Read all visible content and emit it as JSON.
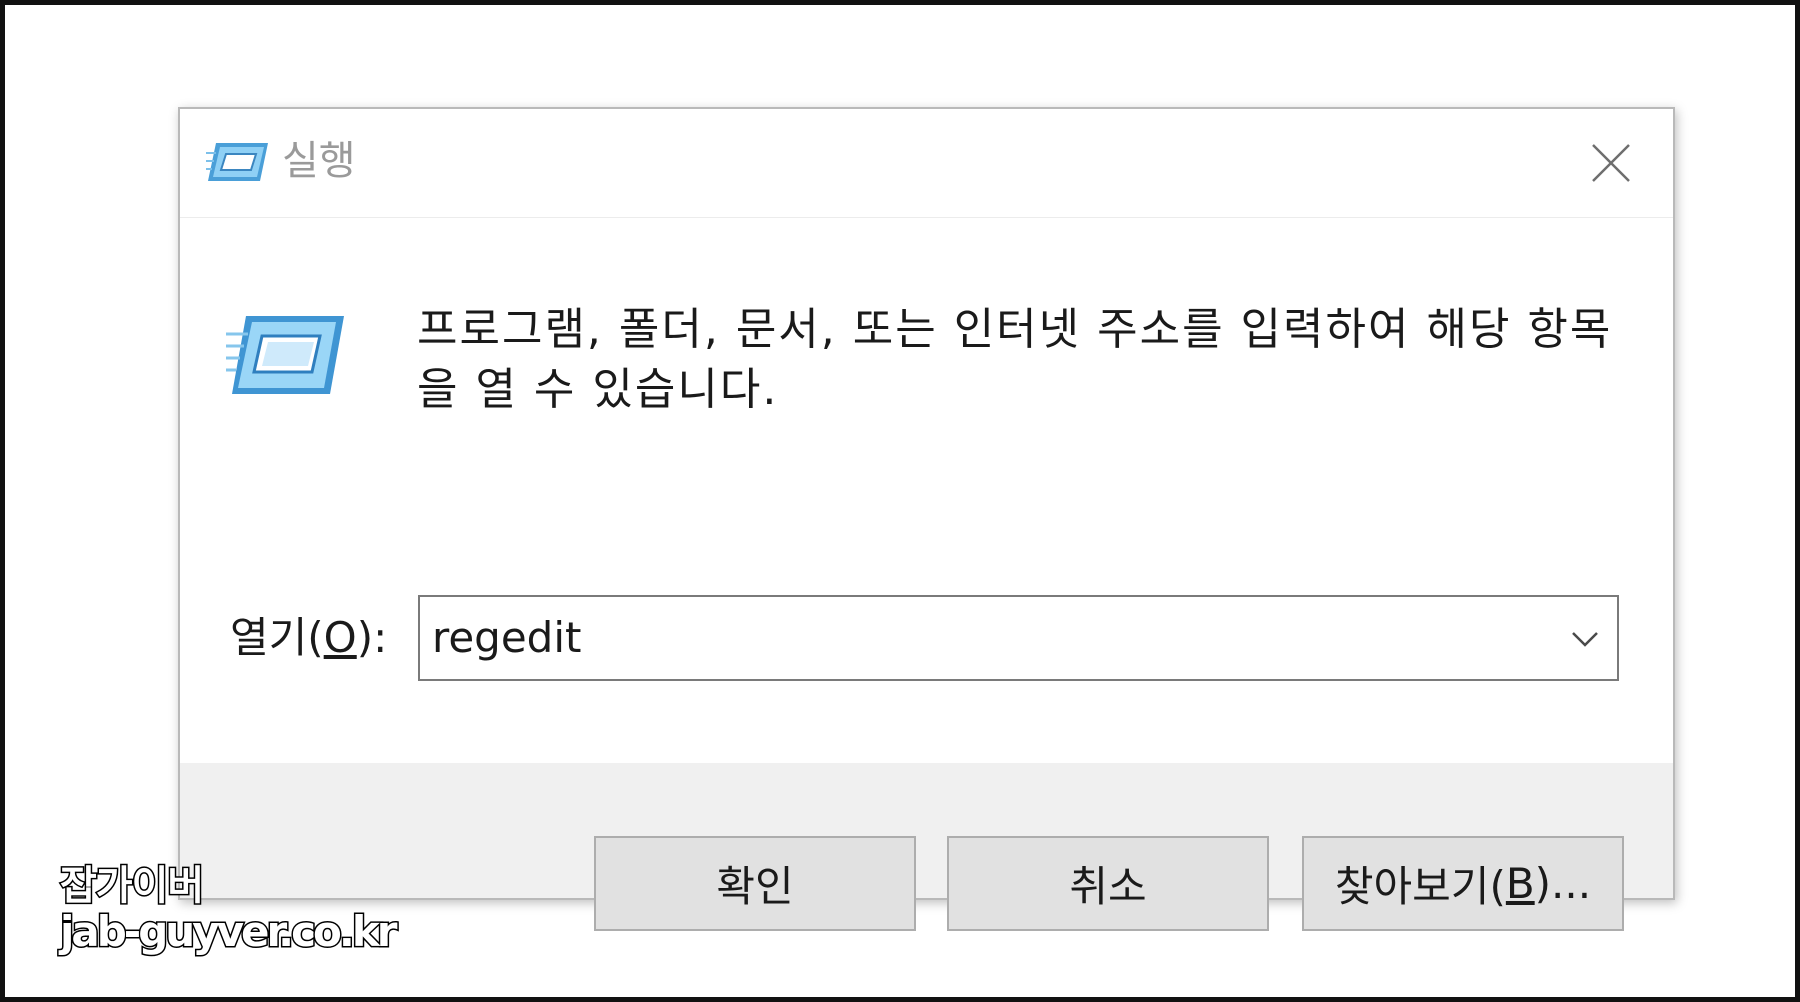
{
  "window": {
    "title": "실행",
    "icon": "run-icon",
    "close_icon": "close-icon"
  },
  "content": {
    "message_line1": "프로그램, 폴더, 문서, 또는 인터넷 주소를 입력하여 해당 항목",
    "message_line2": "을 열 수 있습니다.",
    "open_label_prefix": "열기(",
    "open_label_accel": "O",
    "open_label_suffix": "):",
    "open_value": "regedit"
  },
  "buttons": {
    "ok": "확인",
    "cancel": "취소",
    "browse_prefix": "찾아보기(",
    "browse_accel": "B",
    "browse_suffix": ")..."
  },
  "watermark": {
    "line1": "잡가이버",
    "line2": "jab-guyver.co.kr"
  }
}
